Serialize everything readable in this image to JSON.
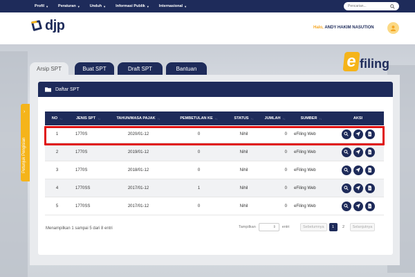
{
  "nav": {
    "menu": [
      "Profil",
      "Peraturan",
      "Unduh",
      "Informasi Publik",
      "Internasional"
    ],
    "search_placeholder": "Pencarian..."
  },
  "header": {
    "logo_text": "djp",
    "greeting": "Halo,",
    "user_name": "ANDY HAKIM NASUTION"
  },
  "sidetab": {
    "label": "Petunjuk Pengisian"
  },
  "tabs": [
    "Arsip SPT",
    "Buat SPT",
    "Draft SPT",
    "Bantuan"
  ],
  "brand": {
    "e": "e",
    "text": "filing"
  },
  "panel": {
    "title": "Daftar SPT"
  },
  "table": {
    "columns": [
      "NO",
      "JENIS SPT",
      "TAHUN/MASA PAJAK",
      "PEMBETULAN KE",
      "STATUS",
      "JUMLAH",
      "SUMBER",
      "AKSI"
    ],
    "rows": [
      {
        "no": "1",
        "jenis": "1770S",
        "tahun": "2020/01-12",
        "pemb": "0",
        "status": "Nihil",
        "jumlah": "0",
        "sumber": "eFiling Web"
      },
      {
        "no": "2",
        "jenis": "1770S",
        "tahun": "2019/01-12",
        "pemb": "0",
        "status": "Nihil",
        "jumlah": "0",
        "sumber": "eFiling Web"
      },
      {
        "no": "3",
        "jenis": "1770S",
        "tahun": "2018/01-12",
        "pemb": "0",
        "status": "Nihil",
        "jumlah": "0",
        "sumber": "eFiling Web"
      },
      {
        "no": "4",
        "jenis": "1770SS",
        "tahun": "2017/01-12",
        "pemb": "1",
        "status": "Nihil",
        "jumlah": "0",
        "sumber": "eFiling Web"
      },
      {
        "no": "5",
        "jenis": "1770SS",
        "tahun": "2017/01-12",
        "pemb": "0",
        "status": "Nihil",
        "jumlah": "0",
        "sumber": "eFiling Web"
      }
    ]
  },
  "footer": {
    "info": "Menampilkan 1 sampai 5 dari 8 entri",
    "show_label": "Tampilkan",
    "show_value": "5",
    "entries_label": "entri",
    "prev": "Sebelumnya",
    "pages": [
      "1",
      "2"
    ],
    "next": "Selanjutnya"
  },
  "colors": {
    "navy": "#1e2b5a",
    "accent": "#f5b41a",
    "highlight": "#e01010"
  }
}
